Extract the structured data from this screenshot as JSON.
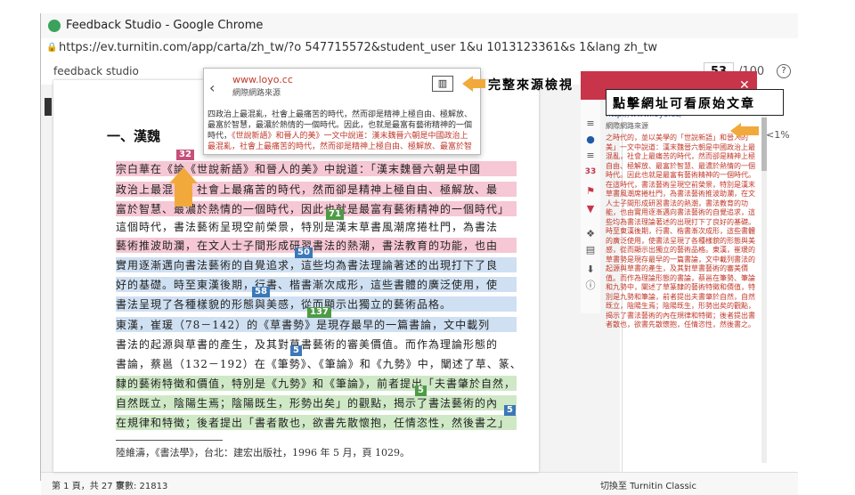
{
  "window": {
    "title": "Feedback Studio - Google Chrome",
    "url": "https://ev.turnitin.com/app/carta/zh_tw/?o 547715572&student_user 1&u 1013123361&s 1&lang zh_tw"
  },
  "toolbar": {
    "logo": "feedback studio",
    "score": "53",
    "score_total": "/100",
    "help": "?"
  },
  "document": {
    "heading": "一、漢魏",
    "lines": [
      "宗白華在《論《世說新語》和晉人的美》中說道：「漢末魏晉六朝是中國",
      "政治上最混亂，社會上最痛苦的時代，然而卻是精神上極自由、極解放、最",
      "富於智慧、最濃於熱情的一個時代，因此也就是最富有藝術精神的一個時代」",
      "這個時代，書法藝術呈現空前榮景，特別是漢末草書風潮席捲杜門，為書法",
      "藝術推波助瀾，在文人士子間形成研習書法的熱潮，書法教育的功能，也由",
      "實用逐漸邁向書法藝術的自覺追求，這些均為書法理論著述的出現打下了良",
      "好的基礎。時至東漢後期，行書、楷書漸次成形，這些書體的廣泛使用，使",
      "書法呈現了各種樣貌的形態與美感，從而顯示出獨立的藝術品格。",
      "東漢，崔瑗（78－142）的《草書勢》是現存最早的一篇書論，文中載列",
      "書法的起源與草書的產生，及其對草書藝術的審美價值。而作為理論形態的",
      "書論，蔡邕（132－192）在《筆勢》、《筆論》和《九勢》中，闡述了草、篆、",
      "隸的藝術特徵和價值，特別是《九勢》和《筆論》，前者提出「夫書肇於自然，",
      "自然既立，陰陽生焉；陰陽既生，形勢出矣」的觀點，揭示了書法藝術的內",
      "在規律和特徵；後者提出「書者散也，欲書先散懷抱，任情恣性，然後書之」"
    ],
    "footnote": "陸維濤，《書法學》，台北：建宏出版社，1996 年 5 月，頁 1029。",
    "badges": [
      "32",
      "71",
      "50",
      "58",
      "137",
      "5",
      "5",
      "5"
    ]
  },
  "popup": {
    "url": "www.loyo.cc",
    "subtitle": "網際網路來源",
    "text_a": "四政治上最混亂，社會上最痛苦的時代，然而卻是精神上極自由、極解放、最富於智慧，最濃於熱情的一個時代。因此，也就是最富有藝術精神的一個時代，",
    "text_b": "《世說新語》和晉人的美》一文中說道：漢末魏晉六朝是中國政治上最混亂，社會上最痛苦的時代，然而卻是精神上極自由、極解放、最富於智慧、最濃"
  },
  "source_panel": {
    "url": "http://www.loyo.cc/",
    "label": "網際網路來源",
    "pct": "<1%",
    "count": "33",
    "text": "之時代的，並以美學的「世說新語」和晉人的美」一文中說道：漢末魏晉六朝是中國政治上最混亂，社會上最痛苦的時代，然而卻是精神上極自由、極解放、最富於智慧、最濃於熱情的一個時代。因此也就是最富有藝術精神的一個時代。在這時代，書法藝術呈現空前榮景，特別是漢末草書風潮席捲杜門，為書法藝術推波助瀾，在文人士子間形成研習書法的熱潮，書法教育的功能，也由實用逐漸邁向書法藝術的自覺追求，這些均為書法理論著述的出現打下了良好的基礎。時至東漢後期，行書、楷書漸次成形，這些書體的廣泛使用，使書法呈現了各種樣貌的形態與美感，從而顯示出獨立的藝術品格。東漢，崔瑗的草書勢是現存最早的一篇書論，文中載列書法的起源與草書的產生，及其對草書藝術的審美價值。而作為理論形態的書論，蔡邕在筆勢、筆論和九勢中，闡述了草篆隸的藝術特徵和價值，特別是九勢和筆論，前者提出夫書肇於自然，自然既立，陰陽生焉；陰陽既生，形勢出矣的觀點，揭示了書法藝術的內在規律和特徵；後者提出書者散也，欲書先散懷抱，任情恣性，然後書之。"
  },
  "status": {
    "pages": "第 1 頁，共 27 頁",
    "words": "字數: 21813",
    "classic": "切換至 Turnitin Classic"
  },
  "annotations": {
    "callout1": "完整來源檢視",
    "callout2": "點擊網址可看原始文章"
  }
}
